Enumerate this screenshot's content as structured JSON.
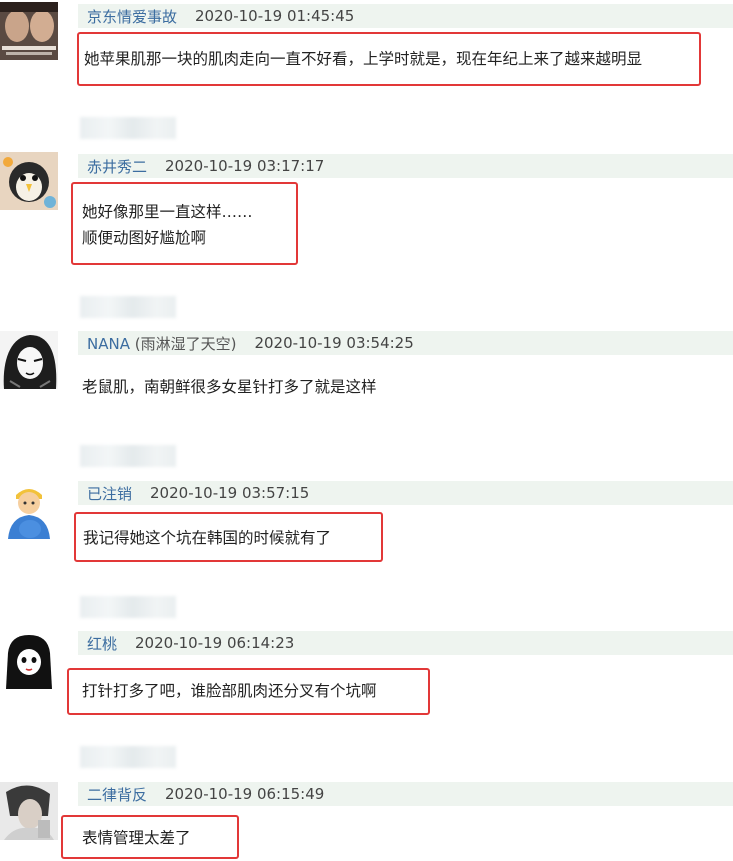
{
  "comments": [
    {
      "user": "京东情爱事故",
      "user_suffix": "",
      "time": "2020-10-19 01:45:45",
      "lines": [
        "她苹果肌那一块的肌肉走向一直不好看，上学时就是，现在年纪上来了越来越明显"
      ],
      "avatar": "photo-avatar"
    },
    {
      "user": "赤井秀二",
      "user_suffix": "",
      "time": "2020-10-19 03:17:17",
      "lines": [
        "她好像那里一直这样……",
        "顺便动图好尴尬啊"
      ],
      "avatar": "bird-avatar"
    },
    {
      "user": "NANA",
      "user_suffix": " (雨淋湿了天空)",
      "time": "2020-10-19 03:54:25",
      "lines": [
        "老鼠肌，南朝鲜很多女星针打多了就是这样"
      ],
      "avatar": "manga-avatar"
    },
    {
      "user": "已注销",
      "user_suffix": "",
      "time": "2020-10-19 03:57:15",
      "lines": [
        "我记得她这个坑在韩国的时候就有了"
      ],
      "avatar": "emoji-person-avatar"
    },
    {
      "user": "红桃",
      "user_suffix": "",
      "time": "2020-10-19 06:14:23",
      "lines": [
        "打针打多了吧，谁脸部肌肉还分叉有个坑啊"
      ],
      "avatar": "girl-drawing-avatar"
    },
    {
      "user": "二律背反",
      "user_suffix": "",
      "time": "2020-10-19 06:15:49",
      "lines": [
        "表情管理太差了"
      ],
      "avatar": "portrait-avatar"
    }
  ]
}
